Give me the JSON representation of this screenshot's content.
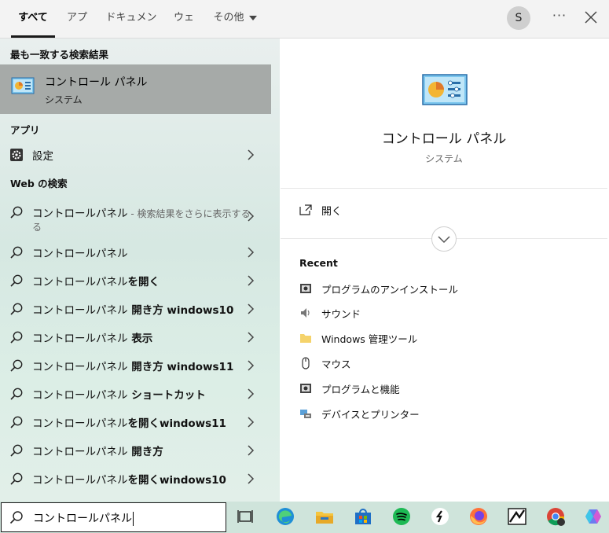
{
  "tabs": [
    {
      "label": "すべて",
      "active": true
    },
    {
      "label": "アプリ",
      "active": false
    },
    {
      "label": "ドキュメント",
      "active": false
    },
    {
      "label": "ウェブ",
      "active": false
    },
    {
      "label": "その他",
      "active": false
    }
  ],
  "header": {
    "avatar_letter": "S",
    "more_label": "···"
  },
  "left": {
    "best_match_heading": "最も一致する検索結果",
    "best_match": {
      "title": "コントロール パネル",
      "subtitle": "システム"
    },
    "apps_heading": "アプリ",
    "apps": [
      {
        "label": "設定",
        "icon": "gear-icon"
      }
    ],
    "web_heading": "Web の検索",
    "web_results": [
      {
        "plain": "コントロールパネル",
        "bold": "",
        "suffix": " - 検索結果をさらに表示する",
        "wrap": "る"
      },
      {
        "plain": "コントロールパネル",
        "bold": "",
        "suffix": "",
        "wrap": ""
      },
      {
        "plain": "コントロールパネル",
        "bold": "を開く",
        "suffix": "",
        "wrap": ""
      },
      {
        "plain": "コントロールパネル",
        "bold": " 開き方 windows10",
        "suffix": "",
        "wrap": ""
      },
      {
        "plain": "コントロールパネル",
        "bold": " 表示",
        "suffix": "",
        "wrap": ""
      },
      {
        "plain": "コントロールパネル",
        "bold": " 開き方 windows11",
        "suffix": "",
        "wrap": ""
      },
      {
        "plain": "コントロールパネル",
        "bold": " ショートカット",
        "suffix": "",
        "wrap": ""
      },
      {
        "plain": "コントロールパネル",
        "bold": "を開くwindows11",
        "suffix": "",
        "wrap": ""
      },
      {
        "plain": "コントロールパネル",
        "bold": " 開き方",
        "suffix": "",
        "wrap": ""
      },
      {
        "plain": "コントロールパネル",
        "bold": "を開くwindows10",
        "suffix": "",
        "wrap": ""
      }
    ]
  },
  "right": {
    "title": "コントロール パネル",
    "subtitle": "システム",
    "open_label": "開く",
    "recent_heading": "Recent",
    "recent": [
      {
        "label": "プログラムのアンインストール",
        "icon": "programs-icon"
      },
      {
        "label": "サウンド",
        "icon": "speaker-icon"
      },
      {
        "label": "Windows 管理ツール",
        "icon": "folder-icon"
      },
      {
        "label": "マウス",
        "icon": "mouse-icon"
      },
      {
        "label": "プログラムと機能",
        "icon": "programs-icon"
      },
      {
        "label": "デバイスとプリンター",
        "icon": "devices-icon"
      }
    ]
  },
  "taskbar": {
    "search_value": "コントロールパネル",
    "icons": [
      "task-view-icon",
      "edge-icon",
      "file-explorer-icon",
      "store-icon",
      "spotify-icon",
      "app-icon",
      "firefox-icon",
      "app-icon",
      "chrome-icon",
      "copilot-icon"
    ]
  },
  "colors": {
    "best_match_bg": "#a6aaa8",
    "taskbar_bg": "#cfe4db",
    "left_pane_bg": "#dceee6"
  }
}
